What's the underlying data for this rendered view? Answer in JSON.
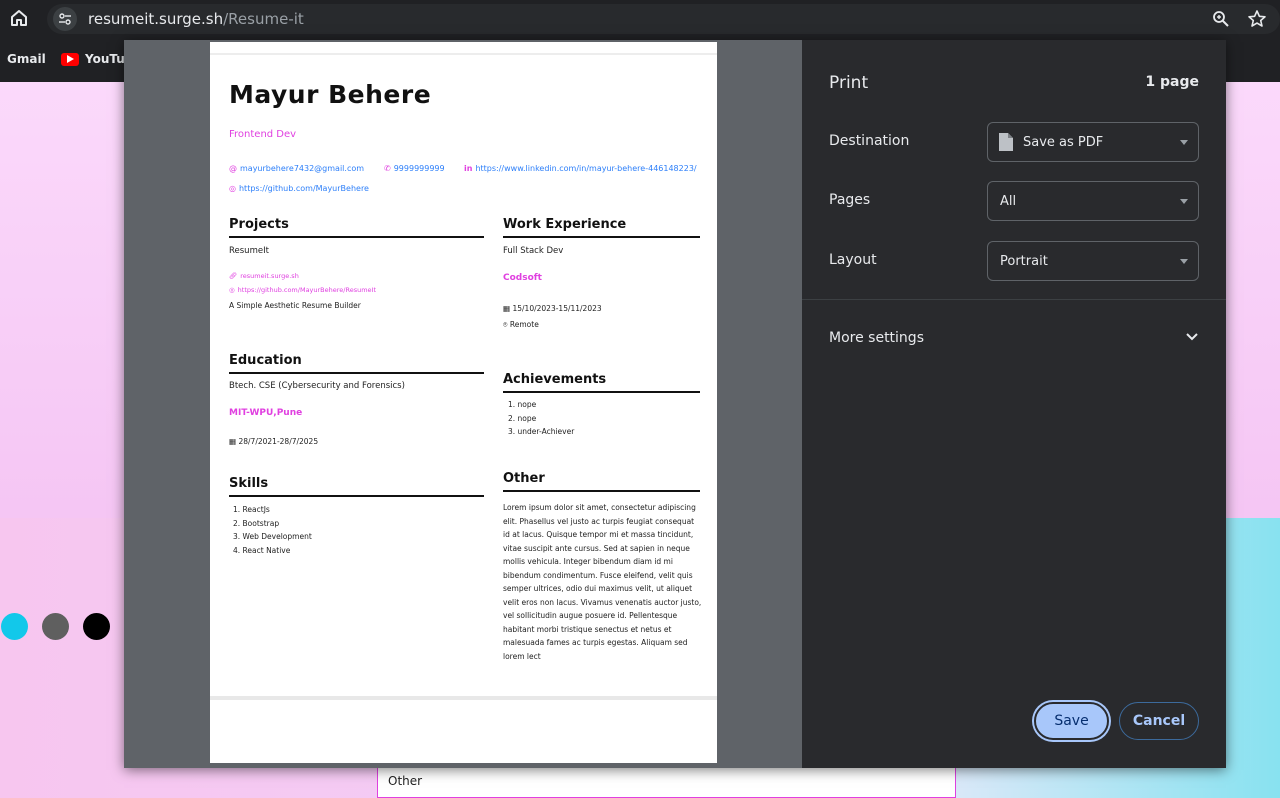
{
  "browser": {
    "domain": "resumeit.surge.sh",
    "path": "/Resume-it",
    "bookmarks": [
      "Gmail",
      "YouTube"
    ]
  },
  "page": {
    "other_input_value": "Other",
    "theme_colors": [
      "#12c8ea",
      "#5f5f5f",
      "#000000"
    ]
  },
  "resume": {
    "name": "Mayur Behere",
    "role": "Frontend Dev",
    "email": "mayurbehere7432@gmail.com",
    "phone": "9999999999",
    "linkedin": "https://www.linkedin.com/in/mayur-behere-446148223/",
    "github": "https://github.com/MayurBehere",
    "projects": {
      "heading": "Projects",
      "title": "ResumeIt",
      "site": "resumeit.surge.sh",
      "repo": "https://github.com/MayurBehere/ResumeIt",
      "description": "A Simple Aesthetic Resume Builder"
    },
    "education": {
      "heading": "Education",
      "degree": "Btech. CSE (Cybersecurity and Forensics)",
      "school": "MIT-WPU,Pune",
      "dates": "28/7/2021-28/7/2025"
    },
    "skills": {
      "heading": "Skills",
      "items": [
        "1. ReactJs",
        "2. Bootstrap",
        "3. Web Development",
        "4. React Native"
      ]
    },
    "work": {
      "heading": "Work Experience",
      "title": "Full Stack Dev",
      "company": "Codsoft",
      "dates": "15/10/2023-15/11/2023",
      "location": "Remote"
    },
    "achievements": {
      "heading": "Achievements",
      "items": [
        "1. nope",
        "2. nope",
        "3. under-Achiever"
      ]
    },
    "other": {
      "heading": "Other",
      "text": "Lorem ipsum dolor sit amet, consectetur adipiscing elit. Phasellus vel justo ac turpis feugiat consequat id at lacus. Quisque tempor mi et massa tincidunt, vitae suscipit ante cursus. Sed at sapien in neque mollis vehicula. Integer bibendum diam id mi bibendum condimentum. Fusce eleifend, velit quis semper ultrices, odio dui maximus velit, ut aliquet velit eros non lacus. Vivamus venenatis auctor justo, vel sollicitudin augue posuere id. Pellentesque habitant morbi tristique senectus et netus et malesuada fames ac turpis egestas. Aliquam sed lorem lect"
    }
  },
  "print": {
    "title": "Print",
    "page_count": "1 page",
    "destination_label": "Destination",
    "destination_value": "Save as PDF",
    "pages_label": "Pages",
    "pages_value": "All",
    "layout_label": "Layout",
    "layout_value": "Portrait",
    "more_settings": "More settings",
    "save": "Save",
    "cancel": "Cancel"
  }
}
